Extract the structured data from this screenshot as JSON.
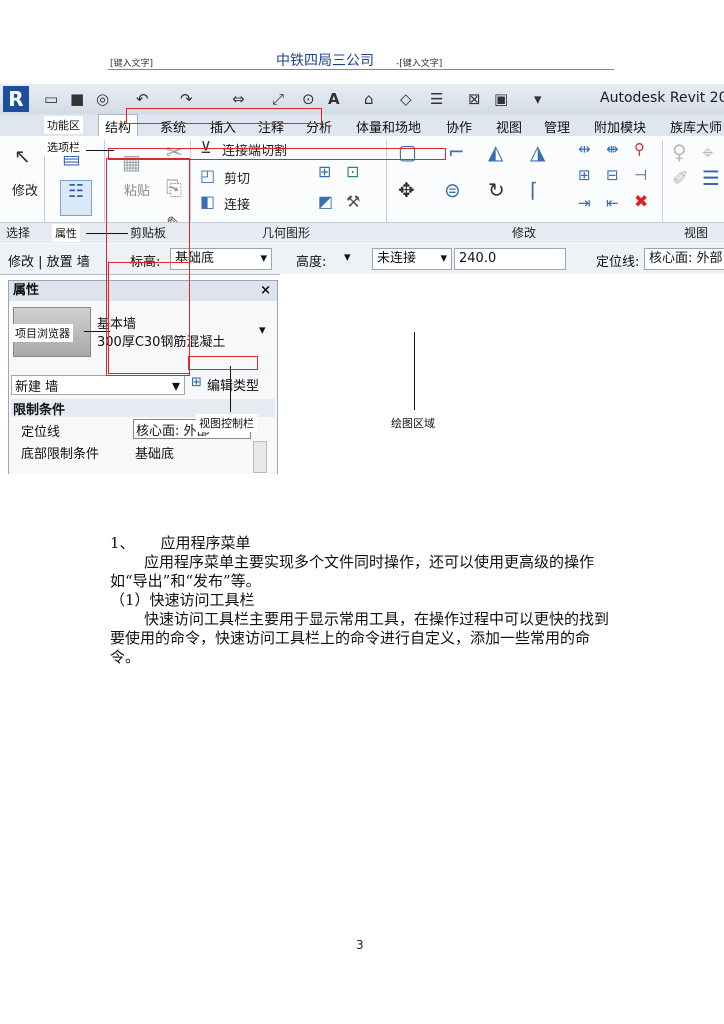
{
  "header": {
    "left_placeholder": "[键入文字]",
    "company": "中铁四局三公司",
    "right_placeholder": "-[键入文字]"
  },
  "screenshot": {
    "logo": "R",
    "app_title": "Autodesk Revit 20",
    "tabs": [
      "结构",
      "系统",
      "插入",
      "注释",
      "分析",
      "体量和场地",
      "协作",
      "视图",
      "管理",
      "附加模块",
      "族库大师"
    ],
    "ribbon": {
      "modify_label": "修改",
      "paste_label": "粘贴",
      "cut_join_label": "连接端切割",
      "cut_label": "剪切",
      "join_label": "连接",
      "panels": [
        "选择",
        "属性",
        "剪贴板",
        "几何图形",
        "修改",
        "视图"
      ]
    },
    "options_bar": {
      "context": "修改 | 放置 墙",
      "level_label": "标高:",
      "level_value": "基础底",
      "height_label": "高度:",
      "constraint_value": "未连接",
      "height_value": "240.0",
      "location_label": "定位线:",
      "location_value": "核心面: 外部"
    },
    "properties": {
      "title": "属性",
      "close": "×",
      "type_family": "基本墙",
      "type_name": "300厚C30钢筋混凝土",
      "instance_filter": "新建 墙",
      "edit_type": "编辑类型",
      "section": "限制条件",
      "rows": [
        {
          "name": "定位线",
          "value": "核心面: 外部"
        },
        {
          "name": "底部限制条件",
          "value": "基础底"
        }
      ]
    },
    "annotations": {
      "ribbon": "功能区",
      "options_bar": "选项栏",
      "properties": "属性",
      "project_browser": "项目浏览器",
      "view_control_bar": "视图控制栏",
      "drawing_area": "绘图区域"
    }
  },
  "body": {
    "heading_number": "1、",
    "heading": "应用程序菜单",
    "para1": "应用程序菜单主要实现多个文件同时操作，还可以使用更高级的操作如“导出”和“发布”等。",
    "subheading": "（1）快速访问工具栏",
    "para2": "快速访问工具栏主要用于显示常用工具，在操作过程中可以更快的找到要使用的命令，快速访问工具栏上的命令进行自定义，添加一些常用的命令。"
  },
  "page_number": "3",
  "colors": {
    "accent_red": "#e0262b",
    "header_blue": "#1f3f8f",
    "revit_blue": "#1d4f9c"
  }
}
